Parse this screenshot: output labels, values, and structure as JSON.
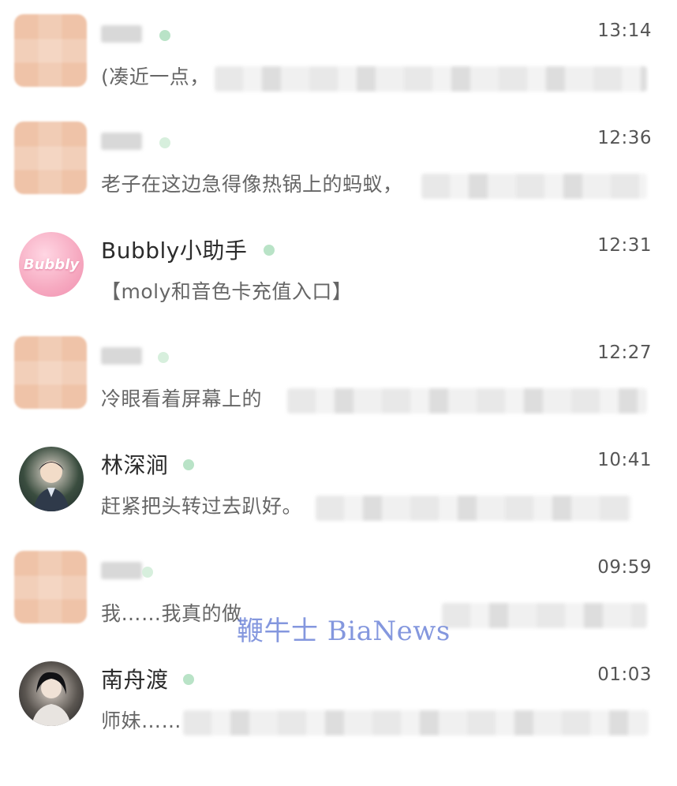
{
  "chats": [
    {
      "name": "",
      "time": "13:14",
      "preview": "(凑近一点，"
    },
    {
      "name": "",
      "time": "12:36",
      "preview": "老子在这边急得像热锅上的蚂蚁，"
    },
    {
      "name": "Bubbly小助手",
      "time": "12:31",
      "preview": "【moly和音色卡充值入口】",
      "avatar_text": "Bubbly"
    },
    {
      "name": "",
      "time": "12:27",
      "preview": "冷眼看着屏幕上的"
    },
    {
      "name": "林深涧",
      "time": "10:41",
      "preview": "赶紧把头转过去趴好。"
    },
    {
      "name": "",
      "time": "09:59",
      "preview": "我……我真的做"
    },
    {
      "name": "南舟渡",
      "time": "01:03",
      "preview": "师妹……"
    }
  ],
  "watermark": "鞭牛士 BiaNews",
  "colors": {
    "online_dot": "#b9e3c7",
    "time_text": "#555555",
    "preview_text": "#666666",
    "bubbly_pink": "#f6a9c0",
    "watermark": "#6f86d9"
  }
}
